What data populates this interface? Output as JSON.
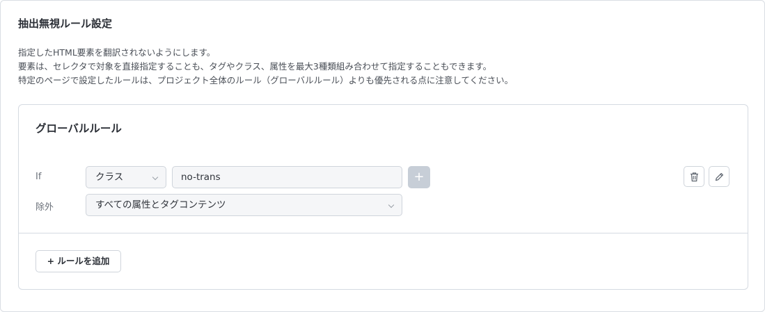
{
  "section": {
    "title": "抽出無視ルール設定",
    "description": [
      "指定したHTML要素を翻訳されないようにします。",
      "要素は、セレクタで対象を直接指定することも、タグやクラス、属性を最大3種類組み合わせて指定することもできます。",
      "特定のページで設定したルールは、プロジェクト全体のルール（グローバルルール）よりも優先される点に注意してください。"
    ]
  },
  "card": {
    "title": "グローバルルール",
    "rule": {
      "if_label": "If",
      "condition_type": "クラス",
      "condition_value": "no-trans",
      "add_condition_symbol": "+",
      "exclude_label": "除外",
      "exclude_value": "すべての属性とタグコンテンツ"
    },
    "icons": {
      "delete": "trash-icon",
      "edit": "pencil-icon",
      "select": "chevron-down-icon"
    },
    "add_rule_label": "+ ルールを追加"
  }
}
